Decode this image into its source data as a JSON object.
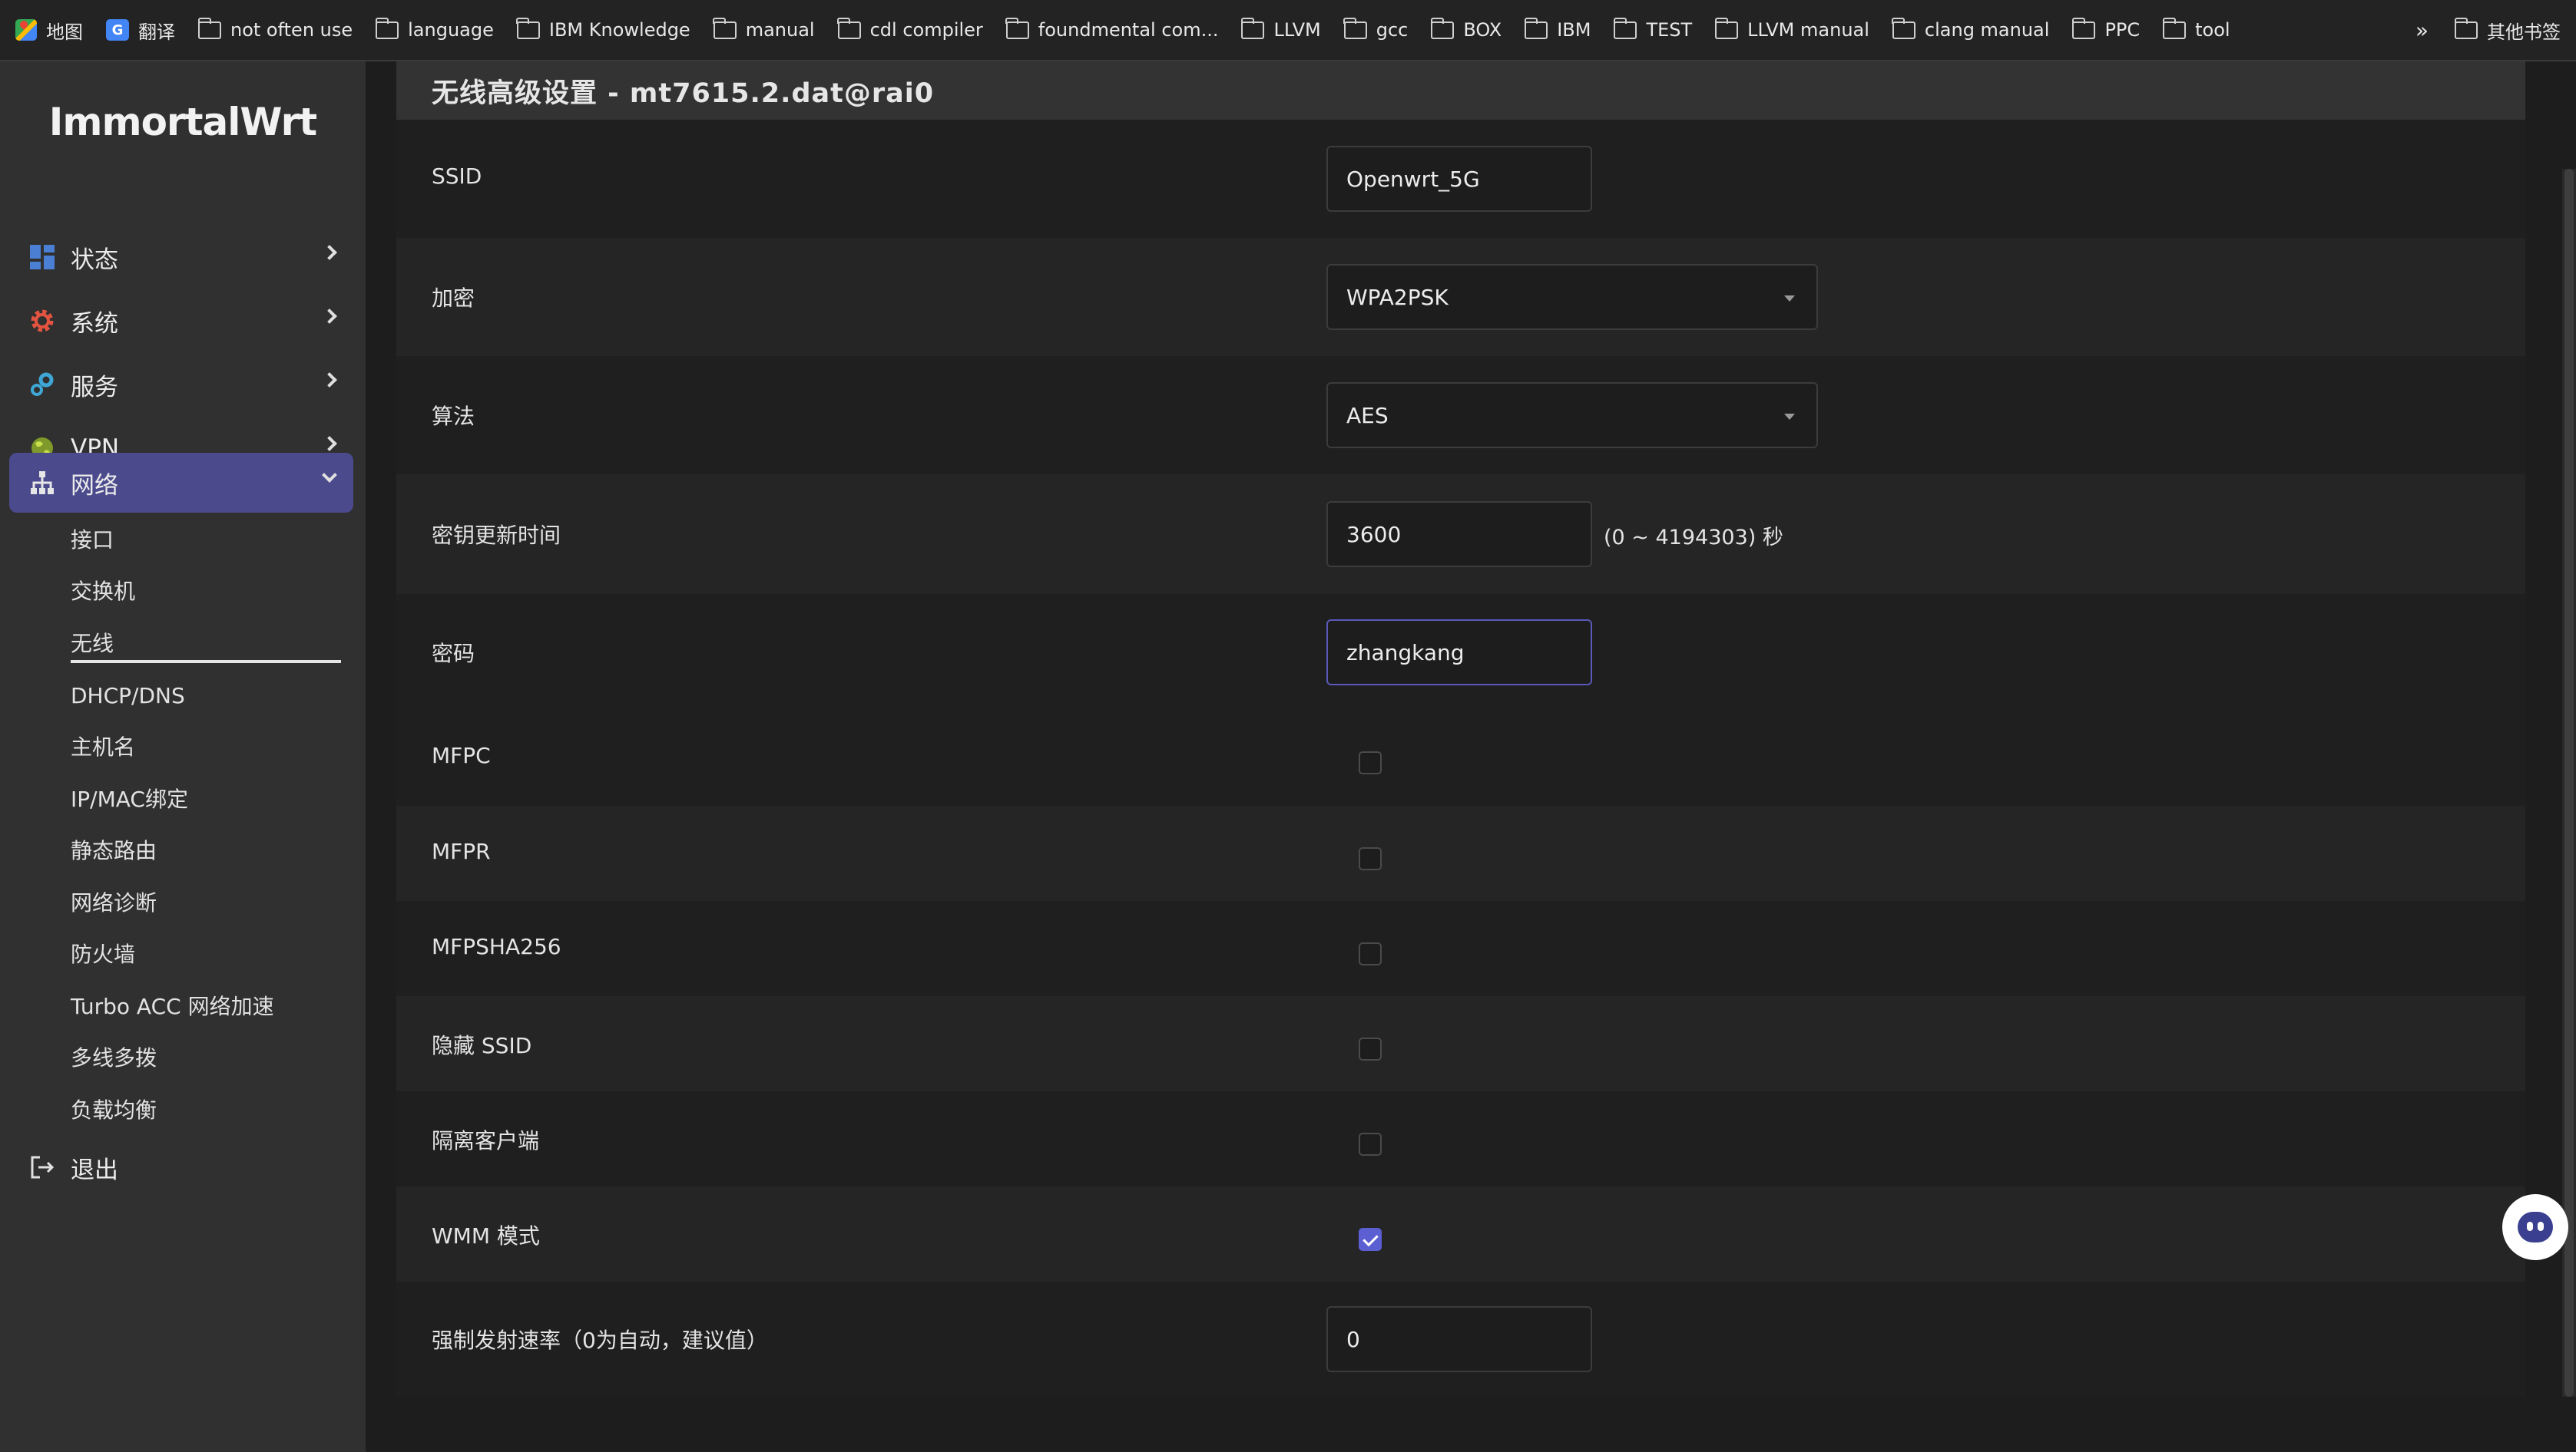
{
  "bookmarks": {
    "items": [
      {
        "label": "地图",
        "icon": "maps-icon"
      },
      {
        "label": "翻译",
        "icon": "translate-icon"
      },
      {
        "label": "not often use",
        "icon": "folder-icon"
      },
      {
        "label": "language",
        "icon": "folder-icon"
      },
      {
        "label": "IBM Knowledge",
        "icon": "folder-icon"
      },
      {
        "label": "manual",
        "icon": "folder-icon"
      },
      {
        "label": "cdl compiler",
        "icon": "folder-icon"
      },
      {
        "label": "foundmental com...",
        "icon": "folder-icon"
      },
      {
        "label": "LLVM",
        "icon": "folder-icon"
      },
      {
        "label": "gcc",
        "icon": "folder-icon"
      },
      {
        "label": "BOX",
        "icon": "folder-icon"
      },
      {
        "label": "IBM",
        "icon": "folder-icon"
      },
      {
        "label": "TEST",
        "icon": "folder-icon"
      },
      {
        "label": "LLVM manual",
        "icon": "folder-icon"
      },
      {
        "label": "clang manual",
        "icon": "folder-icon"
      },
      {
        "label": "PPC",
        "icon": "folder-icon"
      },
      {
        "label": "tool",
        "icon": "folder-icon"
      }
    ],
    "more": "»",
    "other": "其他书签"
  },
  "sidebar": {
    "brand": "ImmortalWrt",
    "menu": [
      {
        "label": "状态",
        "icon": "dashboard-icon",
        "color": "#4a7fd4"
      },
      {
        "label": "系统",
        "icon": "gear-icon",
        "color": "#e2543f"
      },
      {
        "label": "服务",
        "icon": "services-icon",
        "color": "#3fa7d6"
      },
      {
        "label": "VPN",
        "icon": "globe-icon",
        "color": "#a8c83a"
      },
      {
        "label": "网络",
        "icon": "network-icon",
        "color": "#e6e6e6"
      }
    ],
    "submenu": [
      "接口",
      "交换机",
      "无线",
      "DHCP/DNS",
      "主机名",
      "IP/MAC绑定",
      "静态路由",
      "网络诊断",
      "防火墙",
      "Turbo ACC 网络加速",
      "多线多拨",
      "负载均衡"
    ],
    "logout": "退出"
  },
  "main": {
    "title": "无线高级设置 - mt7615.2.dat@rai0",
    "fields": {
      "ssid": {
        "label": "SSID",
        "value": "Openwrt_5G"
      },
      "encryption": {
        "label": "加密",
        "value": "WPA2PSK"
      },
      "algorithm": {
        "label": "算法",
        "value": "AES"
      },
      "rekey": {
        "label": "密钥更新时间",
        "value": "3600",
        "hint": "(0 ~ 4194303) 秒"
      },
      "password": {
        "label": "密码",
        "value": "zhangkang"
      },
      "mfpc": {
        "label": "MFPC",
        "checked": false
      },
      "mfpr": {
        "label": "MFPR",
        "checked": false
      },
      "mfpsha256": {
        "label": "MFPSHA256",
        "checked": false
      },
      "hide_ssid": {
        "label": "隐藏 SSID",
        "checked": false
      },
      "isolate": {
        "label": "隔离客户端",
        "checked": false
      },
      "wmm": {
        "label": "WMM 模式",
        "checked": true
      },
      "tx_rate": {
        "label": "强制发射速率（0为自动，建议值）",
        "value": "0"
      }
    }
  },
  "colors": {
    "accent": "#4b4a8c",
    "checkbox_checked": "#5b5fd1"
  }
}
